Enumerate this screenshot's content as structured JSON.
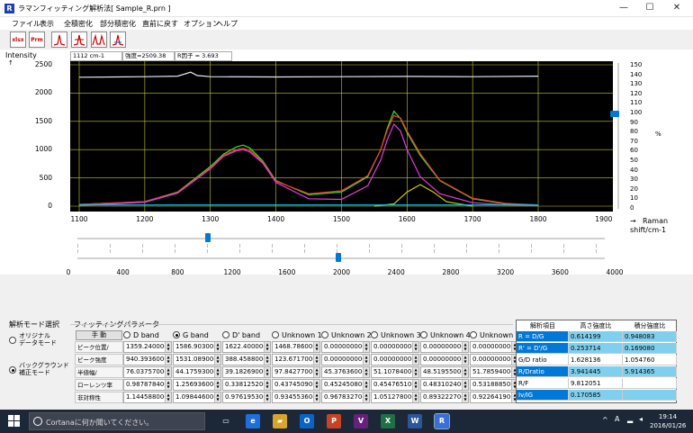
{
  "window": {
    "icon_glyph": "R",
    "title": "ラマンフィッティング解析法[ Sample_R.prn ]",
    "controls": [
      "—",
      "☐",
      "✕"
    ]
  },
  "menu": [
    "ファイル",
    "表示",
    "全積密化",
    "部分積密化",
    "直前に戻す",
    "オプション",
    "ヘルプ"
  ],
  "toolbar": {
    "buttons": [
      {
        "name": "xlsx-export-button",
        "label": "xlsx",
        "icon": "excel-file-icon"
      },
      {
        "name": "prm-export-button",
        "label": "Prm",
        "icon": "prm-file-icon"
      },
      {
        "name": "peak-tool-1-button",
        "label": "",
        "icon": "single-peak-icon"
      },
      {
        "name": "peak-tool-2-button",
        "label": "",
        "icon": "peak-add-icon"
      },
      {
        "name": "peak-tool-3-button",
        "label": "",
        "icon": "double-peak-icon"
      },
      {
        "name": "peak-tool-4-button",
        "label": "",
        "icon": "peak-fit-icon"
      }
    ]
  },
  "info": {
    "position": "1112 cm-1",
    "intensity": "強度=2509.38",
    "r_factor": "R因子 = 3.693"
  },
  "plot": {
    "ylabel": "Intensity",
    "xlabel_arrow": "→",
    "xlabel_line1": "Raman",
    "xlabel_line2": "shift/cm-1",
    "percent_label": "%"
  },
  "chart_data": {
    "type": "line",
    "xlim": [
      1100,
      1800
    ],
    "ylim": [
      0,
      2500
    ],
    "xticks": [
      "1100",
      "1200",
      "1300",
      "1400",
      "1500",
      "1600",
      "1700",
      "1800",
      "1900"
    ],
    "yticks": [
      "2500",
      "2000",
      "1500",
      "1000",
      "500",
      "0"
    ],
    "right_ticks": [
      "150",
      "140",
      "130",
      "120",
      "110",
      "100",
      "90",
      "80",
      "70",
      "60",
      "50",
      "40",
      "30",
      "20",
      "10",
      "0"
    ],
    "lower_axis_ticks": [
      "0",
      "400",
      "800",
      "1200",
      "1600",
      "2000",
      "2400",
      "2800",
      "3200",
      "3600",
      "4000"
    ],
    "grid": true,
    "series": [
      {
        "color": "#2ee62e",
        "x": [
          1100,
          1200,
          1250,
          1300,
          1320,
          1340,
          1350,
          1360,
          1380,
          1400,
          1450,
          1500,
          1540,
          1560,
          1570,
          1580,
          1590,
          1600,
          1620,
          1650,
          1700,
          1750,
          1800
        ],
        "y": [
          30,
          80,
          250,
          700,
          920,
          1050,
          1080,
          1030,
          800,
          450,
          200,
          250,
          520,
          1000,
          1380,
          1680,
          1550,
          1300,
          900,
          450,
          130,
          40,
          20
        ]
      },
      {
        "color": "#ff3030",
        "x": [
          1100,
          1200,
          1250,
          1300,
          1320,
          1340,
          1350,
          1360,
          1380,
          1400,
          1450,
          1500,
          1540,
          1560,
          1570,
          1580,
          1590,
          1600,
          1620,
          1650,
          1700,
          1750,
          1800
        ],
        "y": [
          30,
          80,
          240,
          680,
          900,
          1000,
          1020,
          990,
          780,
          440,
          220,
          270,
          540,
          1000,
          1350,
          1600,
          1560,
          1330,
          930,
          460,
          140,
          50,
          20
        ]
      },
      {
        "color": "#e040e0",
        "x": [
          1100,
          1200,
          1250,
          1300,
          1320,
          1340,
          1350,
          1360,
          1380,
          1400,
          1450,
          1500,
          1540,
          1560,
          1570,
          1580,
          1590,
          1600,
          1620,
          1650,
          1700,
          1750,
          1800
        ],
        "y": [
          10,
          70,
          230,
          660,
          880,
          980,
          1000,
          960,
          760,
          420,
          130,
          120,
          360,
          820,
          1180,
          1450,
          1330,
          1000,
          520,
          220,
          60,
          20,
          10
        ]
      },
      {
        "color": "#c8c000",
        "x": [
          1550,
          1580,
          1600,
          1620,
          1640,
          1660,
          1700
        ],
        "y": [
          0,
          40,
          250,
          380,
          250,
          80,
          0
        ]
      },
      {
        "color": "#00c8ff",
        "x": [
          1100,
          1800
        ],
        "y": [
          20,
          20
        ]
      },
      {
        "color": "#e8e8e8",
        "x": [
          1100,
          1200,
          1250,
          1270,
          1280,
          1300,
          1400,
          1500,
          1600,
          1700,
          1800
        ],
        "y": [
          2280,
          2290,
          2300,
          2370,
          2310,
          2290,
          2285,
          2290,
          2295,
          2290,
          2300
        ]
      }
    ]
  },
  "mode": {
    "title": "解析モード選択",
    "original_line1": "オリジナル",
    "original_line2": "データモード",
    "bg_line1": "バックグラウンド",
    "bg_line2": "補正モード"
  },
  "params": {
    "title": "フィッティングパラメータ",
    "manual_label": "手 動",
    "columns": [
      "D band",
      "G band",
      "D' band",
      "Unknown 1",
      "Unknown 2",
      "Unknown 3",
      "Unknown 4",
      "Unknown 5"
    ],
    "selected_column": 1,
    "row_labels": [
      "ピーク位置/",
      "ピーク強度",
      "半値幅/",
      "ローレンツ率",
      "非対称性"
    ],
    "rows": [
      [
        "1359.24000(",
        "1586.90300(",
        "1622.40000(",
        "1468.78600(",
        "0.00000000(",
        "0.00000000(",
        "0.00000000(",
        "0.00000000("
      ],
      [
        "940.393600(",
        "1531.08900(",
        "388.458800(",
        "123.671700(",
        "0.00000000(",
        "0.00000000(",
        "0.00000000(",
        "0.00000000("
      ],
      [
        "76.0375700(",
        "44.1759300(",
        "39.1826900(",
        "97.8427700(",
        "45.3763600(",
        "51.1078400(",
        "48.5195500(",
        "51.7859400("
      ],
      [
        "0.98787840(",
        "1.25693600(",
        "0.33812520(",
        "0.43745090(",
        "0.45245080(",
        "0.45476510(",
        "0.48310240(",
        "0.53188850("
      ],
      [
        "1.14458800(",
        "1.09844600(",
        "0.97619530(",
        "0.93455360(",
        "0.96783270(",
        "1.05127800(",
        "0.89322270(",
        "0.92264190("
      ]
    ]
  },
  "analysis": {
    "headers": [
      "解析項目",
      "高さ強度比",
      "積分強度比"
    ],
    "rows": [
      {
        "item": "R = D/G",
        "height": "0.614199",
        "area": "0.948083",
        "highlight": true
      },
      {
        "item": "R' = D'/G",
        "height": "0.253714",
        "area": "0.169080",
        "highlight": true
      },
      {
        "item": "G/D ratio",
        "height": "1.628136",
        "area": "1.054760",
        "highlight": false
      },
      {
        "item": "R/Dratio",
        "height": "3.941445",
        "area": "5.914365",
        "highlight": true
      },
      {
        "item": "R/F",
        "height": "9.812051",
        "area": "",
        "highlight": false
      },
      {
        "item": "Iv/IG",
        "height": "0.170585",
        "area": "",
        "highlight": true
      }
    ],
    "colors": {
      "accent": "#0078d7",
      "highlight": "#7fd0ee",
      "pale": "#dff2fb"
    }
  },
  "taskbar": {
    "search_placeholder": "Cortanaに何か聞いてください。",
    "apps": [
      {
        "name": "task-view-icon",
        "color": "#1c2838",
        "glyph": "▭"
      },
      {
        "name": "edge-icon",
        "color": "#1e6fd9",
        "glyph": "e"
      },
      {
        "name": "explorer-icon",
        "color": "#d9a42a",
        "glyph": "▰"
      },
      {
        "name": "outlook-icon",
        "color": "#0a64c7",
        "glyph": "O"
      },
      {
        "name": "powerpoint-icon",
        "color": "#c84224",
        "glyph": "P"
      },
      {
        "name": "visualstudio-icon",
        "color": "#68217a",
        "glyph": "V"
      },
      {
        "name": "excel-icon",
        "color": "#1e7145",
        "glyph": "X"
      },
      {
        "name": "word-icon",
        "color": "#2b579a",
        "glyph": "W"
      },
      {
        "name": "raman-app-icon",
        "color": "#3a6fd8",
        "glyph": "R"
      }
    ],
    "tray_caret": "^",
    "ime": "A",
    "time": "19:14",
    "date": "2016/01/26"
  }
}
